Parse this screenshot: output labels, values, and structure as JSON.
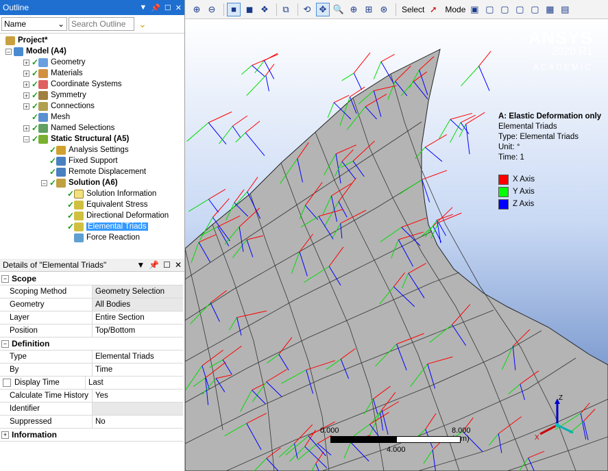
{
  "outline": {
    "title": "Outline",
    "filter_value": "Name",
    "search_placeholder": "Search Outline",
    "tree": [
      {
        "label": "Project*",
        "bold": true
      },
      {
        "label": "Model (A4)",
        "bold": true
      },
      {
        "label": "Geometry"
      },
      {
        "label": "Materials"
      },
      {
        "label": "Coordinate Systems"
      },
      {
        "label": "Symmetry"
      },
      {
        "label": "Connections"
      },
      {
        "label": "Mesh"
      },
      {
        "label": "Named Selections"
      },
      {
        "label": "Static Structural (A5)",
        "bold": true
      },
      {
        "label": "Analysis Settings"
      },
      {
        "label": "Fixed Support"
      },
      {
        "label": "Remote Displacement"
      },
      {
        "label": "Solution (A6)",
        "bold": true
      },
      {
        "label": "Solution Information"
      },
      {
        "label": "Equivalent Stress"
      },
      {
        "label": "Directional Deformation"
      },
      {
        "label": "Elemental Triads",
        "selected": true
      },
      {
        "label": "Force Reaction"
      }
    ]
  },
  "details": {
    "title": "Details of \"Elemental Triads\"",
    "groups": [
      {
        "name": "Scope",
        "rows": [
          {
            "k": "Scoping Method",
            "v": "Geometry Selection"
          },
          {
            "k": "Geometry",
            "v": "All Bodies"
          },
          {
            "k": "Layer",
            "v": "Entire Section"
          },
          {
            "k": "Position",
            "v": "Top/Bottom"
          }
        ]
      },
      {
        "name": "Definition",
        "rows": [
          {
            "k": "Type",
            "v": "Elemental Triads"
          },
          {
            "k": "By",
            "v": "Time"
          },
          {
            "k": "Display Time",
            "v": "Last"
          },
          {
            "k": "Calculate Time History",
            "v": "Yes"
          },
          {
            "k": "Identifier",
            "v": ""
          },
          {
            "k": "Suppressed",
            "v": "No"
          }
        ]
      },
      {
        "name": "Information",
        "rows": []
      }
    ]
  },
  "toolbar": {
    "select_label": "Select",
    "mode_label": "Mode"
  },
  "brand": {
    "name": "ANSYS",
    "version": "2020 R1",
    "edition": "ACADEMIC"
  },
  "legend": {
    "title": "A: Elastic Deformation only",
    "subtitle": "Elemental Triads",
    "type": "Type: Elemental Triads",
    "unit": "Unit: °",
    "time": "Time: 1",
    "items": [
      {
        "label": "X Axis",
        "color": "#ff0000"
      },
      {
        "label": "Y Axis",
        "color": "#00ff00"
      },
      {
        "label": "Z Axis",
        "color": "#0000ff"
      }
    ]
  },
  "scale": {
    "left": "0.000",
    "right": "8.000 (mm)",
    "mid": "4.000"
  },
  "triad": {
    "z": "Z",
    "x": "X"
  }
}
